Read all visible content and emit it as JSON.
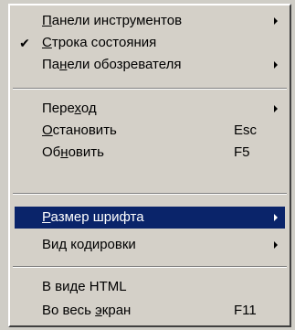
{
  "menu": {
    "items": [
      {
        "pre": "",
        "acc": "П",
        "post": "анели инструментов",
        "shortcut": "",
        "submenu": true,
        "checked": false
      },
      {
        "pre": "",
        "acc": "С",
        "post": "трока состояния",
        "shortcut": "",
        "submenu": false,
        "checked": true
      },
      {
        "pre": "Па",
        "acc": "н",
        "post": "ели обозревателя",
        "shortcut": "",
        "submenu": true,
        "checked": false
      },
      {
        "pre": "Пере",
        "acc": "х",
        "post": "од",
        "shortcut": "",
        "submenu": true,
        "checked": false
      },
      {
        "pre": "",
        "acc": "О",
        "post": "становить",
        "shortcut": "Esc",
        "submenu": false,
        "checked": false
      },
      {
        "pre": "Об",
        "acc": "н",
        "post": "овить",
        "shortcut": "F5",
        "submenu": false,
        "checked": false
      },
      {
        "pre": "",
        "acc": "Р",
        "post": "азмер шрифта",
        "shortcut": "",
        "submenu": true,
        "checked": false
      },
      {
        "pre": "Вид ко",
        "acc": "д",
        "post": "ировки",
        "shortcut": "",
        "submenu": true,
        "checked": false
      },
      {
        "pre": "В ви",
        "acc": "д",
        "post": "е HTML",
        "shortcut": "",
        "submenu": false,
        "checked": false
      },
      {
        "pre": "Во весь ",
        "acc": "э",
        "post": "кран",
        "shortcut": "F11",
        "submenu": false,
        "checked": false
      }
    ],
    "check_glyph": "✔",
    "highlight_color": "#0a246a"
  }
}
